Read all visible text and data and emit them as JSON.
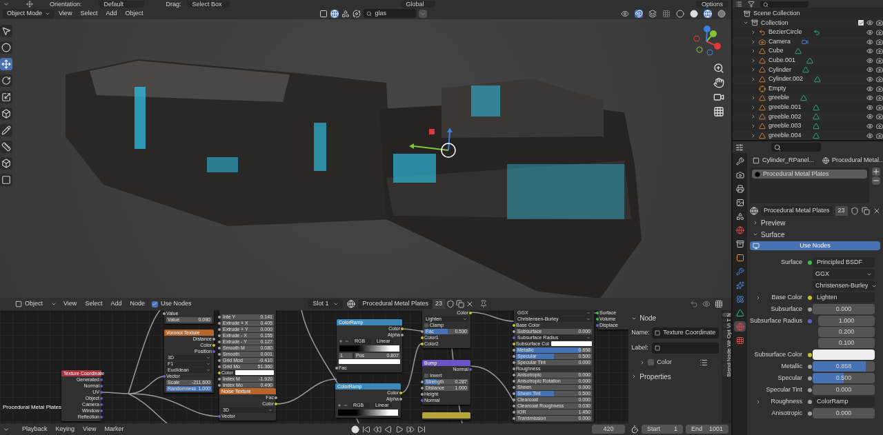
{
  "tool_settings": {
    "orientation_label": "Orientation:",
    "orientation": "Default",
    "drag_label": "Drag:",
    "drag": "Select Box",
    "transform_orientation": "Global",
    "options": "Options"
  },
  "viewport_header": {
    "mode": "Object Mode",
    "menus": [
      "View",
      "Select",
      "Add",
      "Object"
    ],
    "search": "glas"
  },
  "outliner": {
    "tree": [
      {
        "name": "Scene Collection",
        "kind": "scene",
        "children": [
          {
            "name": "Collection",
            "kind": "collection",
            "checked": true,
            "expanded": true,
            "children": [
              {
                "name": "BezierCircle",
                "kind": "curve",
                "expanded": false
              },
              {
                "name": "Camera",
                "kind": "camera",
                "expanded": false
              },
              {
                "name": "Cube",
                "kind": "mesh",
                "expanded": false
              },
              {
                "name": "Cube.001",
                "kind": "mesh",
                "expanded": false
              },
              {
                "name": "Cylinder",
                "kind": "mesh",
                "expanded": false
              },
              {
                "name": "Cylinder.002",
                "kind": "mesh",
                "expanded": false
              },
              {
                "name": "Empty",
                "kind": "empty"
              },
              {
                "name": "greeble",
                "kind": "mesh",
                "expanded": false
              },
              {
                "name": "greeble.001",
                "kind": "mesh",
                "expanded": false
              },
              {
                "name": "greeble.002",
                "kind": "mesh",
                "expanded": false
              },
              {
                "name": "greeble.003",
                "kind": "mesh",
                "expanded": false
              },
              {
                "name": "greeble.004",
                "kind": "mesh",
                "expanded": false
              }
            ]
          }
        ]
      }
    ]
  },
  "properties": {
    "tabs": [
      {
        "kind": "tool",
        "selected": false
      },
      {
        "kind": "render",
        "selected": false
      },
      {
        "kind": "output",
        "selected": false
      },
      {
        "kind": "view-layer",
        "selected": false
      },
      {
        "kind": "scene",
        "selected": false
      },
      {
        "kind": "world",
        "selected": false
      },
      {
        "kind": "collection",
        "selected": false
      },
      {
        "kind": "object",
        "selected": false
      },
      {
        "kind": "modifier",
        "selected": false
      },
      {
        "kind": "particles",
        "selected": false
      },
      {
        "kind": "physics",
        "selected": false
      },
      {
        "kind": "data",
        "selected": false
      },
      {
        "kind": "material",
        "selected": true
      },
      {
        "kind": "texture",
        "selected": false
      }
    ],
    "breadcrumb": [
      "Cylinder_RPanel...",
      "Procedural Metal..."
    ],
    "slots": [
      {
        "name": "Procedural Metal Plates",
        "selected": true
      }
    ],
    "material": {
      "name": "Procedural Metal Plates",
      "users": "23"
    },
    "panels": [
      {
        "title": "Preview",
        "expanded": false
      },
      {
        "title": "Surface",
        "expanded": true
      }
    ],
    "use_nodes": "Use Nodes",
    "fields": [
      {
        "kind": "link",
        "label": "Surface",
        "value": "Principled BSDF",
        "color": "#3fbf4f"
      },
      {
        "kind": "dropdown",
        "value": "GGX"
      },
      {
        "kind": "dropdown",
        "value": "Christensen-Burley"
      },
      {
        "kind": "link",
        "label": "Base Color",
        "value": "Lighten",
        "color": "#c7c729",
        "expanded": false
      },
      {
        "kind": "number",
        "label": "Subsurface",
        "values": [
          "0.000"
        ],
        "color": "#a1a1a1"
      },
      {
        "kind": "number",
        "label": "Subsurface Radius",
        "values": [
          "1.000",
          "0.200",
          "0.100"
        ],
        "color": "#6363c7"
      },
      {
        "kind": "swatch",
        "label": "Subsurface Color",
        "color": "#c7c729"
      },
      {
        "kind": "slider",
        "label": "Metallic",
        "values": [
          "0.858"
        ],
        "level": 0.858,
        "color": "#a1a1a1"
      },
      {
        "kind": "slider",
        "label": "Specular",
        "values": [
          "0.500"
        ],
        "level": 0.5,
        "color": "#a1a1a1"
      },
      {
        "kind": "number",
        "label": "Specular Tint",
        "values": [
          "0.000"
        ],
        "color": "#a1a1a1"
      },
      {
        "kind": "link",
        "label": "Roughness",
        "value": "ColorRamp",
        "color": "#a1a1a1",
        "expanded": false
      },
      {
        "kind": "number",
        "label": "Anisotropic",
        "values": [
          "0.000"
        ],
        "color": "#a1a1a1"
      }
    ]
  },
  "node_header": {
    "type": "Object",
    "menus": [
      "View",
      "Select",
      "Add",
      "Node"
    ],
    "use_nodes": {
      "label": "Use Nodes",
      "checked": true
    },
    "slot": "Slot 1",
    "material": "Procedural Metal Plates",
    "users": "23"
  },
  "node_canvas": {
    "label": "Procedural Metal Plates",
    "nodes": [
      {
        "title": "Texture Coordinate",
        "color": "#a8323f",
        "rows": [
          {
            "kind": "out",
            "label": "Generated",
            "color": "#6363c7"
          },
          {
            "kind": "out",
            "label": "Normal",
            "color": "#6363c7"
          },
          {
            "kind": "out",
            "label": "UV",
            "color": "#6363c7"
          },
          {
            "kind": "out",
            "label": "Object",
            "color": "#6363c7"
          },
          {
            "kind": "out",
            "label": "Camera",
            "color": "#6363c7"
          },
          {
            "kind": "out",
            "label": "Window",
            "color": "#6363c7"
          },
          {
            "kind": "out",
            "label": "Reflection",
            "color": "#6363c7"
          }
        ]
      },
      {
        "rows": [
          {
            "kind": "in",
            "label": "Value",
            "color": "#a1a1a1"
          },
          {
            "kind": "field",
            "label": "Value",
            "value": "0.090"
          }
        ]
      },
      {
        "title": "Voronoi Texture",
        "color": "#b8652c",
        "rows": [
          {
            "kind": "out",
            "label": "Distance",
            "color": "#a1a1a1"
          },
          {
            "kind": "out",
            "label": "Color",
            "color": "#c7c729"
          },
          {
            "kind": "out",
            "label": "Position",
            "color": "#6363c7"
          },
          {
            "kind": "dropdown",
            "value": "3D"
          },
          {
            "kind": "dropdown",
            "value": "F1"
          },
          {
            "kind": "dropdown",
            "value": "Euclidean"
          },
          {
            "kind": "in",
            "label": "Vector",
            "color": "#6363c7"
          },
          {
            "kind": "field",
            "label": "Scale",
            "value": "-211.600"
          },
          {
            "kind": "field",
            "label": "Randomness",
            "value": "1.000",
            "level": 1
          }
        ]
      },
      {
        "rows": [
          {
            "kind": "field",
            "label": "Inte Y",
            "value": "0.141",
            "color": "#a1a1a1"
          },
          {
            "kind": "field",
            "label": "Extrude + X",
            "value": "0.405",
            "color": "#a1a1a1"
          },
          {
            "kind": "field",
            "label": "Extrude + Y",
            "value": "0.000",
            "color": "#a1a1a1"
          },
          {
            "kind": "field",
            "label": "Extrude - X",
            "value": "0.155",
            "color": "#a1a1a1"
          },
          {
            "kind": "field",
            "label": "Extrude - Y",
            "value": "0.127",
            "color": "#a1a1a1"
          },
          {
            "kind": "field",
            "label": "Smooth M",
            "value": "0.080",
            "color": "#a1a1a1"
          },
          {
            "kind": "field",
            "label": "Smooth",
            "value": "0.001",
            "color": "#a1a1a1"
          },
          {
            "kind": "field",
            "label": "Grid Mod",
            "value": "-0.410",
            "color": "#a1a1a1"
          },
          {
            "kind": "field",
            "label": "Grid Mo",
            "value": "51.360",
            "color": "#a1a1a1"
          },
          {
            "kind": "swatch",
            "label": "Color",
            "color": "#c7c729"
          },
          {
            "kind": "field",
            "label": "Index M",
            "value": "-1.920",
            "color": "#a1a1a1"
          },
          {
            "kind": "field",
            "label": "Index Mo",
            "value": "0.490",
            "color": "#a1a1a1"
          }
        ]
      },
      {
        "title": "Noise Texture",
        "color": "#b8652c",
        "rows": [
          {
            "kind": "out",
            "label": "Fac",
            "color": "#a1a1a1"
          },
          {
            "kind": "out",
            "label": "Color",
            "color": "#c7c729"
          },
          {
            "kind": "dropdown",
            "value": "3D"
          },
          {
            "kind": "in",
            "label": "Vector",
            "color": "#6363c7"
          }
        ]
      },
      {
        "title": "ColorRamp",
        "color": "#3d86b8",
        "rows": [
          {
            "kind": "out",
            "label": "Color",
            "color": "#c7c729"
          },
          {
            "kind": "out",
            "label": "Alpha",
            "color": "#a1a1a1"
          },
          {
            "kind": "ramp-controls",
            "values": [
              "RGB",
              "Linear"
            ]
          },
          {
            "kind": "ramp"
          },
          {
            "kind": "ramp-pos",
            "values": [
              "1",
              "Pos",
              "0.807"
            ]
          },
          {
            "kind": "white"
          },
          {
            "kind": "in",
            "label": "Fac",
            "color": "#a1a1a1"
          }
        ]
      },
      {
        "title": "ColorRamp",
        "color": "#3d86b8",
        "rows": [
          {
            "kind": "out",
            "label": "Color",
            "color": "#c7c729"
          },
          {
            "kind": "out",
            "label": "Alpha",
            "color": "#a1a1a1"
          },
          {
            "kind": "ramp-controls",
            "values": [
              "RGB",
              "Linear"
            ]
          },
          {
            "kind": "ramp"
          }
        ]
      },
      {
        "rows": [
          {
            "kind": "out",
            "label": "Color",
            "color": "#c7c729"
          },
          {
            "kind": "dropdown",
            "value": "Lighten"
          },
          {
            "kind": "check",
            "label": "Clamp",
            "checked": false
          },
          {
            "kind": "field",
            "label": "Fac",
            "value": "0.530",
            "level": 0.53,
            "color": "#a1a1a1"
          },
          {
            "kind": "in",
            "label": "Color1",
            "color": "#c7c729"
          },
          {
            "kind": "in",
            "label": "Color2",
            "color": "#c7c729"
          }
        ]
      },
      {
        "title": "Bump",
        "color": "#6c52c4",
        "rows": [
          {
            "kind": "out",
            "label": "Normal",
            "color": "#6363c7"
          },
          {
            "kind": "check",
            "label": "Invert",
            "checked": false
          },
          {
            "kind": "field",
            "label": "Strength",
            "value": "0.287",
            "level": 0.287,
            "color": "#a1a1a1"
          },
          {
            "kind": "field",
            "label": "Distance",
            "value": "1.000",
            "color": "#a1a1a1"
          },
          {
            "kind": "in",
            "label": "Height",
            "color": "#a1a1a1"
          },
          {
            "kind": "in",
            "label": "Normal",
            "color": "#6363c7"
          }
        ]
      },
      {
        "color": "#b3a43a"
      },
      {
        "rows": [
          {
            "kind": "dropdown",
            "value": "GGX"
          },
          {
            "kind": "dropdown",
            "value": "Christensen-Burley"
          },
          {
            "kind": "in",
            "label": "Base Color",
            "color": "#c7c729"
          },
          {
            "kind": "field",
            "label": "Subsurface",
            "value": "0.000",
            "color": "#a1a1a1"
          },
          {
            "kind": "dropdown",
            "value": "Subsurface Radius",
            "color": "#6363c7"
          },
          {
            "kind": "swatch",
            "label": "Subsurface Col",
            "color": "#c7c729"
          },
          {
            "kind": "field",
            "label": "Metallic",
            "value": "0.858",
            "level": 0.858,
            "color": "#a1a1a1"
          },
          {
            "kind": "field",
            "label": "Specular",
            "value": "0.500",
            "level": 0.5,
            "color": "#a1a1a1"
          },
          {
            "kind": "field",
            "label": "Specular Tint",
            "value": "0.000",
            "color": "#a1a1a1"
          },
          {
            "kind": "in",
            "label": "Roughness",
            "color": "#a1a1a1"
          },
          {
            "kind": "field",
            "label": "Anisotropic",
            "value": "0.000",
            "color": "#a1a1a1"
          },
          {
            "kind": "field",
            "label": "Anisotropic Rotation",
            "value": "0.000",
            "color": "#a1a1a1"
          },
          {
            "kind": "field",
            "label": "Sheen",
            "value": "0.000",
            "color": "#a1a1a1"
          },
          {
            "kind": "field",
            "label": "Sheen Tint",
            "value": "0.500",
            "level": 0.5,
            "color": "#a1a1a1"
          },
          {
            "kind": "field",
            "label": "Clearcoat",
            "value": "0.000",
            "color": "#a1a1a1"
          },
          {
            "kind": "field",
            "label": "Clearcoat Roughness",
            "value": "0.030",
            "color": "#a1a1a1"
          },
          {
            "kind": "field",
            "label": "IOR",
            "value": "1.450",
            "color": "#a1a1a1"
          },
          {
            "kind": "field",
            "label": "Transmission",
            "value": "0.000",
            "color": "#a1a1a1"
          }
        ]
      },
      {
        "rows": [
          {
            "kind": "in",
            "label": "Surface",
            "color": "#3fbf4f"
          },
          {
            "kind": "in",
            "label": "Volume",
            "color": "#3fbf4f"
          },
          {
            "kind": "in",
            "label": "Displace",
            "color": "#6363c7"
          }
        ]
      }
    ]
  },
  "node_sidebar": {
    "tabs": [
      {
        "label": "N",
        "selected": true
      },
      {
        "label": "T",
        "selected": false
      },
      {
        "label": "Vi",
        "selected": false
      },
      {
        "label": "Opt",
        "selected": false
      },
      {
        "label": "Node Wr",
        "selected": false
      },
      {
        "label": "Blend",
        "selected": false
      }
    ],
    "panel": {
      "title": "Node",
      "expanded": true
    },
    "name_label": "Name:",
    "name": "Texture Coordinate",
    "label_label": "Label:",
    "color_option": {
      "label": "Color",
      "checked": false,
      "expanded": false
    },
    "properties": {
      "title": "Properties",
      "expanded": false
    }
  },
  "timeline": {
    "menus": [
      "Playback",
      "Keying",
      "View",
      "Marker"
    ],
    "frame": "420",
    "start_label": "Start",
    "start": "1",
    "end_label": "End",
    "end": "1001"
  }
}
